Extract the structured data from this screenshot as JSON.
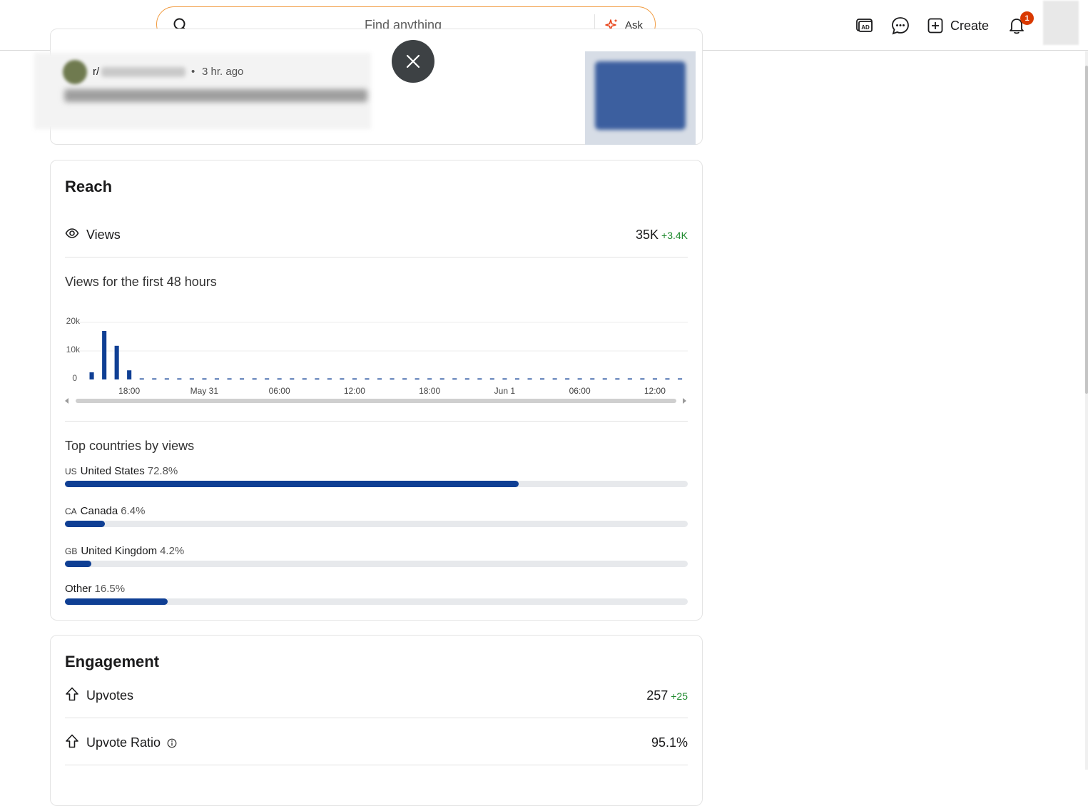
{
  "search": {
    "placeholder": "Find anything",
    "ask_label": "Ask"
  },
  "topbar": {
    "create_label": "Create",
    "notification_count": "1"
  },
  "post": {
    "subreddit_prefix": "r/",
    "time": "3 hr. ago",
    "separator": "•"
  },
  "reach": {
    "title": "Reach",
    "views_label": "Views",
    "views_value": "35K",
    "views_delta": "+3.4K",
    "chart_title": "Views for the first 48 hours",
    "top_countries_title": "Top countries by views",
    "countries": [
      {
        "code": "US",
        "name": "United States",
        "pct": "72.8%",
        "value": 72.8
      },
      {
        "code": "CA",
        "name": "Canada",
        "pct": "6.4%",
        "value": 6.4
      },
      {
        "code": "GB",
        "name": "United Kingdom",
        "pct": "4.2%",
        "value": 4.2
      },
      {
        "code": "",
        "name": "Other",
        "pct": "16.5%",
        "value": 16.5
      }
    ]
  },
  "engagement": {
    "title": "Engagement",
    "upvotes_label": "Upvotes",
    "upvotes_value": "257",
    "upvotes_delta": "+25",
    "ratio_label": "Upvote Ratio",
    "ratio_value": "95.1%"
  },
  "colors": {
    "bar": "#0f3f94",
    "delta": "#1f8a2e",
    "search_border": "#f19a3e",
    "badge": "#d93900"
  },
  "chart_data": {
    "type": "bar",
    "title": "Views for the first 48 hours",
    "ylim": [
      0,
      20000
    ],
    "y_ticks": [
      "0",
      "10k",
      "20k"
    ],
    "x_tick_labels": [
      "18:00",
      "May 31",
      "06:00",
      "12:00",
      "18:00",
      "Jun 1",
      "06:00",
      "12:00"
    ],
    "values": [
      2500,
      17000,
      11800,
      3200,
      0,
      0,
      0,
      0,
      0,
      0,
      0,
      0,
      0,
      0,
      0,
      0,
      0,
      0,
      0,
      0,
      0,
      0,
      0,
      0,
      0,
      0,
      0,
      0,
      0,
      0,
      0,
      0,
      0,
      0,
      0,
      0,
      0,
      0,
      0,
      0,
      0,
      0,
      0,
      0,
      0,
      0,
      0,
      0
    ],
    "grid": true
  }
}
